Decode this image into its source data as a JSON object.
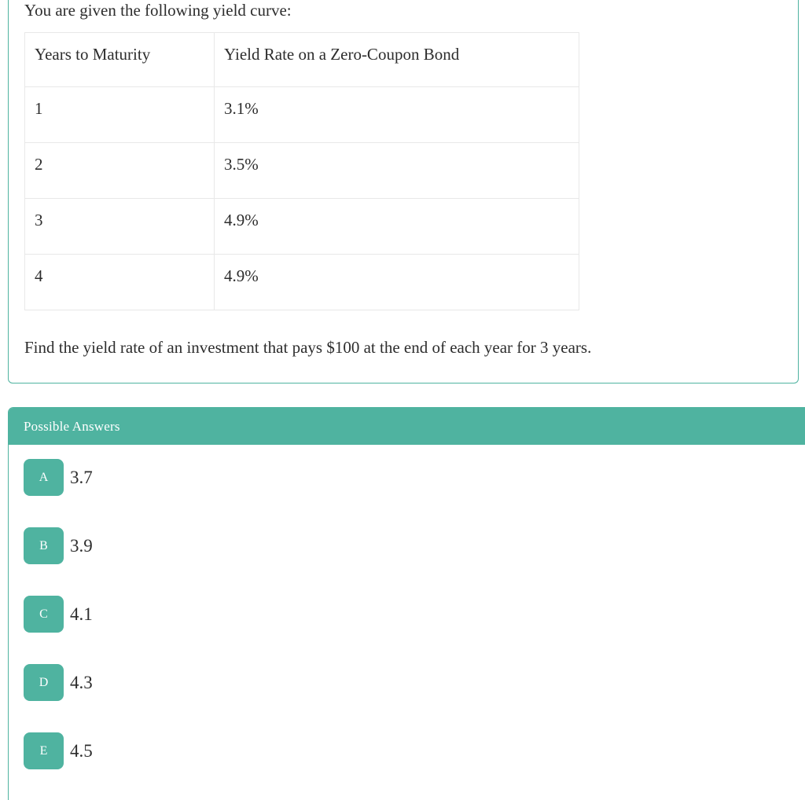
{
  "question": {
    "intro": "You are given the following yield curve:",
    "table": {
      "headers": [
        "Years to Maturity",
        "Yield Rate on a Zero-Coupon Bond"
      ],
      "rows": [
        [
          "1",
          "3.1%"
        ],
        [
          "2",
          "3.5%"
        ],
        [
          "3",
          "4.9%"
        ],
        [
          "4",
          "4.9%"
        ]
      ]
    },
    "prompt": "Find the yield rate of an investment that pays $100 at the end of each year for 3 years."
  },
  "answers": {
    "title": "Possible Answers",
    "options": [
      {
        "letter": "A",
        "value": "3.7"
      },
      {
        "letter": "B",
        "value": "3.9"
      },
      {
        "letter": "C",
        "value": "4.1"
      },
      {
        "letter": "D",
        "value": "4.3"
      },
      {
        "letter": "E",
        "value": "4.5"
      }
    ]
  },
  "colors": {
    "accent": "#4fb3a0",
    "text": "#2d2d2d",
    "table_border": "#e8e8e8"
  }
}
